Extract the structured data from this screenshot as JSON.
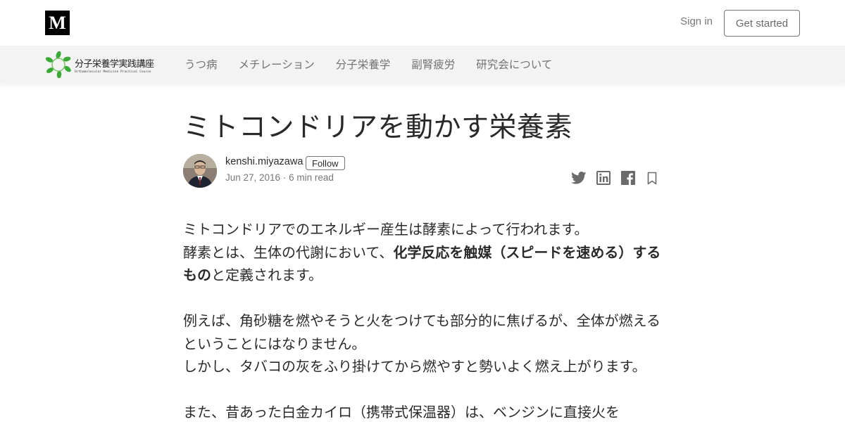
{
  "header": {
    "logo_letter": "M",
    "signin_label": "Sign in",
    "get_started_label": "Get started"
  },
  "publication": {
    "logo_title": "分子栄養学実践講座",
    "logo_subtitle": "Orthomolecular Medicine Practical Course",
    "logo_color": "#3aa935",
    "nav": [
      "うつ病",
      "メチレーション",
      "分子栄養学",
      "副腎疲労",
      "研究会について"
    ]
  },
  "article": {
    "title": "ミトコンドリアを動かす栄養素",
    "author": "kenshi.miyazawa",
    "follow_label": "Follow",
    "date": "Jun 27, 2016",
    "separator": "·",
    "read_time": "6 min read",
    "share_icons": [
      "twitter-icon",
      "linkedin-icon",
      "facebook-icon",
      "bookmark-icon"
    ],
    "paragraphs": {
      "p1_line1": "ミトコンドリアでのエネルギー産生は酵素によって行われます。",
      "p1_line2_pre": "酵素とは、生体の代謝において、",
      "p1_line2_bold": "化学反応を触媒（スピードを速める）するもの",
      "p1_line2_post": "と定義されます。",
      "p2_line1": "例えば、角砂糖を燃やそうと火をつけても部分的に焦げるが、全体が燃えるということにはなりません。",
      "p2_line2": "しかし、タバコの灰をふり掛けてから燃やすと勢いよく燃え上がります。",
      "p3_line1": "また、昔あった白金カイロ（携帯式保温器）は、ベンジンに直接火を"
    }
  }
}
